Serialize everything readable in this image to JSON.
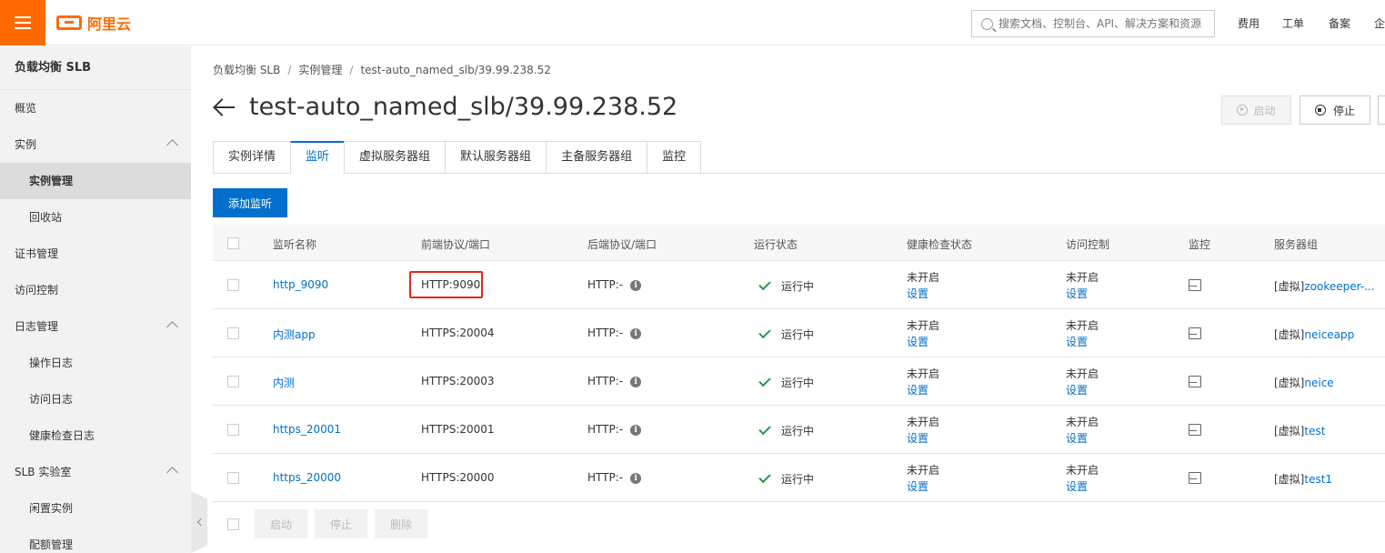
{
  "topbar": {
    "logo_text": "阿里云",
    "search_placeholder": "搜索文档、控制台、API、解决方案和资源",
    "nav": [
      "费用",
      "工单",
      "备案",
      "企"
    ]
  },
  "sidebar": {
    "title": "负载均衡 SLB",
    "items": [
      {
        "label": "概览",
        "level": 1
      },
      {
        "label": "实例",
        "level": 1,
        "expanded": true
      },
      {
        "label": "实例管理",
        "level": 2,
        "active": true
      },
      {
        "label": "回收站",
        "level": 2
      },
      {
        "label": "证书管理",
        "level": 1
      },
      {
        "label": "访问控制",
        "level": 1
      },
      {
        "label": "日志管理",
        "level": 1,
        "expanded": true
      },
      {
        "label": "操作日志",
        "level": 2
      },
      {
        "label": "访问日志",
        "level": 2
      },
      {
        "label": "健康检查日志",
        "level": 2
      },
      {
        "label": "SLB 实验室",
        "level": 1,
        "expanded": true
      },
      {
        "label": "闲置实例",
        "level": 2
      },
      {
        "label": "配额管理",
        "level": 2
      }
    ]
  },
  "breadcrumb": [
    "负载均衡 SLB",
    "实例管理",
    "test-auto_named_slb/39.99.238.52"
  ],
  "page_title": "test-auto_named_slb/39.99.238.52",
  "actions": {
    "start": "启动",
    "stop": "停止"
  },
  "tabs": [
    {
      "label": "实例详情",
      "active": false
    },
    {
      "label": "监听",
      "active": true
    },
    {
      "label": "虚拟服务器组",
      "active": false
    },
    {
      "label": "默认服务器组",
      "active": false
    },
    {
      "label": "主备服务器组",
      "active": false
    },
    {
      "label": "监控",
      "active": false
    }
  ],
  "add_listener": "添加监听",
  "table": {
    "headers": [
      "监听名称",
      "前端协议/端口",
      "后端协议/端口",
      "运行状态",
      "健康检查状态",
      "访问控制",
      "监控",
      "服务器组"
    ],
    "rows": [
      {
        "name": "http_9090",
        "frontend": "HTTP:9090",
        "backend": "HTTP:-",
        "status": "运行中",
        "health": "未开启",
        "health_link": "设置",
        "acl": "未开启",
        "acl_link": "设置",
        "group": "[虚拟]",
        "group_link": "zookeeper-...",
        "highlighted": true
      },
      {
        "name": "内测app",
        "frontend": "HTTPS:20004",
        "backend": "HTTP:-",
        "status": "运行中",
        "health": "未开启",
        "health_link": "设置",
        "acl": "未开启",
        "acl_link": "设置",
        "group": "[虚拟]",
        "group_link": "neiceapp"
      },
      {
        "name": "内测",
        "frontend": "HTTPS:20003",
        "backend": "HTTP:-",
        "status": "运行中",
        "health": "未开启",
        "health_link": "设置",
        "acl": "未开启",
        "acl_link": "设置",
        "group": "[虚拟]",
        "group_link": "neice"
      },
      {
        "name": "https_20001",
        "frontend": "HTTPS:20001",
        "backend": "HTTP:-",
        "status": "运行中",
        "health": "未开启",
        "health_link": "设置",
        "acl": "未开启",
        "acl_link": "设置",
        "group": "[虚拟]",
        "group_link": "test"
      },
      {
        "name": "https_20000",
        "frontend": "HTTPS:20000",
        "backend": "HTTP:-",
        "status": "运行中",
        "health": "未开启",
        "health_link": "设置",
        "acl": "未开启",
        "acl_link": "设置",
        "group": "[虚拟]",
        "group_link": "test1"
      }
    ]
  },
  "bulk_actions": [
    "启动",
    "停止",
    "删除"
  ],
  "colors": {
    "brand": "#ff6a00",
    "primary": "#0070cc",
    "success": "#1e9e4a",
    "highlight": "#e0281a"
  },
  "icons": [
    "menu-icon",
    "logo-icon",
    "search-icon",
    "back-arrow-icon",
    "play-icon",
    "stop-icon",
    "info-icon",
    "check-icon",
    "monitor-icon",
    "chevron-up-icon",
    "chevron-left-icon"
  ]
}
